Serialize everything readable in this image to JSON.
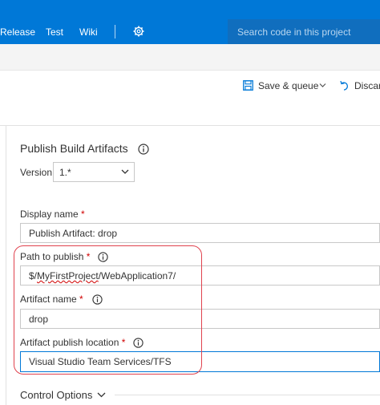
{
  "nav": {
    "items": [
      "Release",
      "Test",
      "Wiki"
    ],
    "search_placeholder": "Search code in this project"
  },
  "toolbar": {
    "save_label": "Save & queue",
    "discard_label": "Discar"
  },
  "task": {
    "title": "Publish Build Artifacts",
    "version_label": "Version",
    "version_value": "1.*"
  },
  "fields": {
    "display_name": {
      "label": "Display name",
      "required": "*",
      "value": "Publish Artifact: drop"
    },
    "path_to_publish": {
      "label": "Path to publish",
      "required": "*",
      "value_prefix": "$/",
      "value_squiggle": "MyFirstProject",
      "value_suffix": "/WebApplication7/"
    },
    "artifact_name": {
      "label": "Artifact name",
      "required": "*",
      "value": "drop"
    },
    "publish_location": {
      "label": "Artifact publish location",
      "required": "*",
      "value": "Visual Studio Team Services/TFS"
    }
  },
  "control_options": {
    "label": "Control Options"
  },
  "colors": {
    "nav_bg": "#0078d7",
    "highlight": "#e0424e",
    "required": "#d00000"
  }
}
